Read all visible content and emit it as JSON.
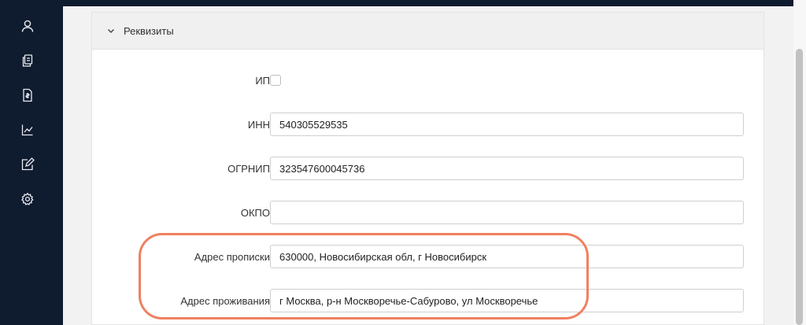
{
  "sidebar": {
    "items": [
      {
        "icon": "user-icon"
      },
      {
        "icon": "documents-icon"
      },
      {
        "icon": "invoice-icon"
      },
      {
        "icon": "chart-icon"
      },
      {
        "icon": "edit-icon"
      },
      {
        "icon": "gear-icon"
      }
    ]
  },
  "panel": {
    "title": "Реквизиты",
    "chevron_icon": "chevron-down-icon"
  },
  "form": {
    "ip_label": "ИП",
    "ip_checked": false,
    "inn_label": "ИНН",
    "inn_value": "540305529535",
    "ogrnip_label": "ОГРНИП",
    "ogrnip_value": "323547600045736",
    "okpo_label": "ОКПО",
    "okpo_value": "",
    "reg_address_label": "Адрес прописки",
    "reg_address_value": "630000, Новосибирская обл, г Новосибирск",
    "live_address_label": "Адрес проживания",
    "live_address_value": "г Москва, р-н Москворечье-Сабурово, ул Москворечье"
  },
  "colors": {
    "sidebar_bg": "#0f1b2e",
    "highlight": "#f08060"
  }
}
